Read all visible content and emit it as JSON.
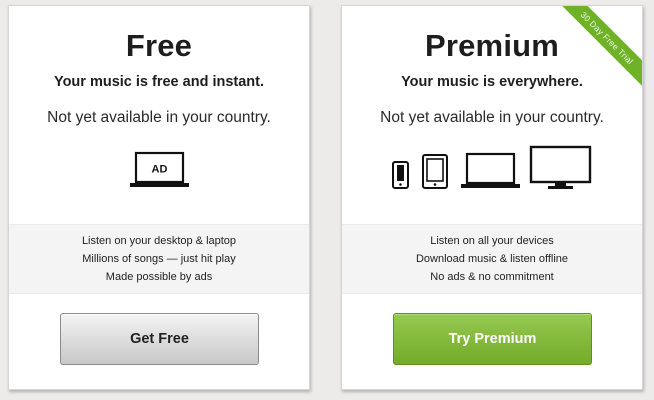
{
  "plans": {
    "free": {
      "title": "Free",
      "tagline": "Your music is free and instant.",
      "availability": "Not yet available in your country.",
      "device_icon_label": "AD",
      "features": [
        "Listen on your desktop & laptop",
        "Millions of songs — just hit play",
        "Made possible by ads"
      ],
      "button_label": "Get Free"
    },
    "premium": {
      "title": "Premium",
      "tagline": "Your music is everywhere.",
      "availability": "Not yet available in your country.",
      "ribbon": "30 Day Free Trial",
      "features": [
        "Listen on all your devices",
        "Download music & listen offline",
        "No ads & no commitment"
      ],
      "button_label": "Try Premium"
    }
  },
  "icons": {
    "free_devices": [
      "laptop-ad-icon"
    ],
    "premium_devices": [
      "phone-icon",
      "tablet-icon",
      "laptop-icon",
      "monitor-icon"
    ]
  },
  "colors": {
    "background": "#ecebea",
    "premium_green": "#80b83a",
    "ribbon_green": "#6fb228",
    "text": "#1e1e1e"
  }
}
